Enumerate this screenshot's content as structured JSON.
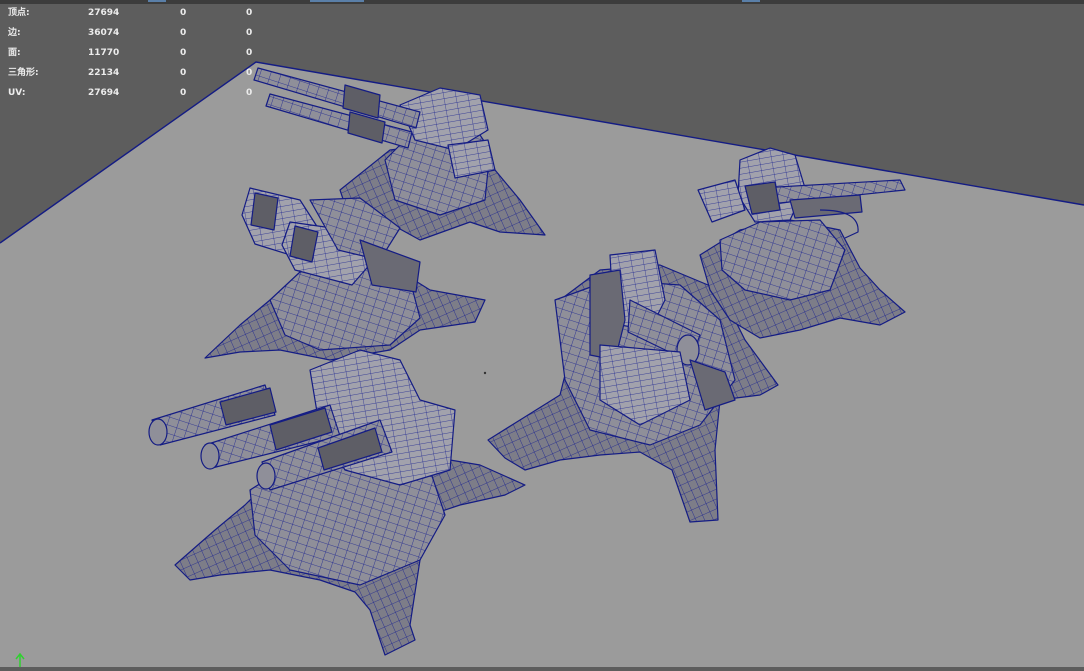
{
  "scene": {
    "background_color": "#5d5d5d",
    "ground_color": "#9b9b9b",
    "wire_color": "#141c84",
    "mesh_fill": "#8f8f99",
    "mesh_shadow": "#5e5e66",
    "objects": [
      "turret-twin-cannon",
      "turret-missile-pod",
      "turret-gatling-quad",
      "turret-heavy-cannon",
      "turret-back-right"
    ]
  },
  "hud": {
    "rows": [
      {
        "label": "顶点:",
        "total": "27694",
        "sel1": "0",
        "sel2": "0"
      },
      {
        "label": "边:",
        "total": "36074",
        "sel1": "0",
        "sel2": "0"
      },
      {
        "label": "面:",
        "total": "11770",
        "sel1": "0",
        "sel2": "0"
      },
      {
        "label": "三角形:",
        "total": "22134",
        "sel1": "0",
        "sel2": "0"
      },
      {
        "label": "UV:",
        "total": "27694",
        "sel1": "0",
        "sel2": "0"
      }
    ]
  },
  "axis_gizmo": {
    "icon": "y-axis-icon",
    "color": "#2fd12f"
  }
}
